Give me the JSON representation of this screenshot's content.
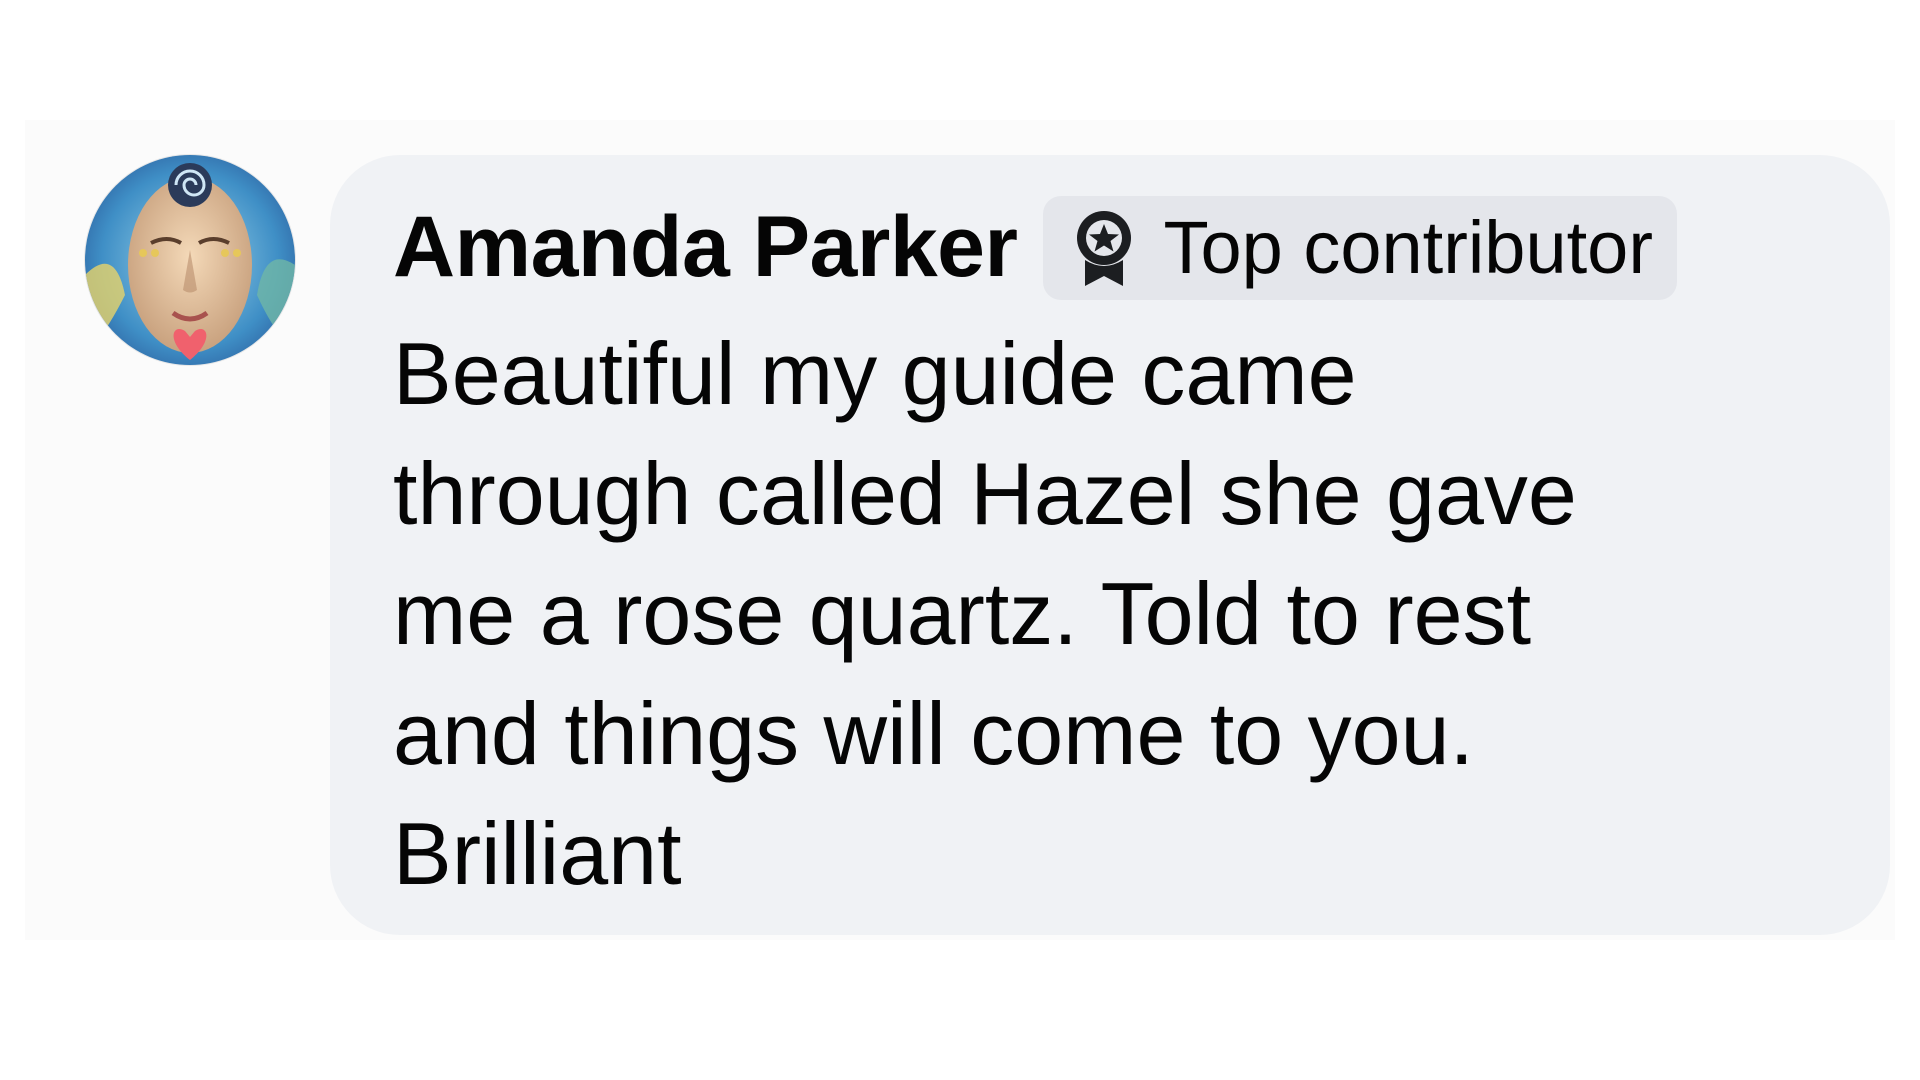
{
  "comment": {
    "author": "Amanda Parker",
    "badge_label": "Top contributor",
    "badge_icon": "award-ribbon-icon",
    "avatar": "profile-portrait",
    "text_lines": [
      "Beautiful my guide came",
      "through called Hazel she gave",
      "me a rose quartz. Told to rest",
      "and things will come to you.",
      "Brilliant"
    ]
  },
  "colors": {
    "bubble_background": "#f0f2f5",
    "badge_background": "#e4e6eb",
    "text": "#050505"
  }
}
